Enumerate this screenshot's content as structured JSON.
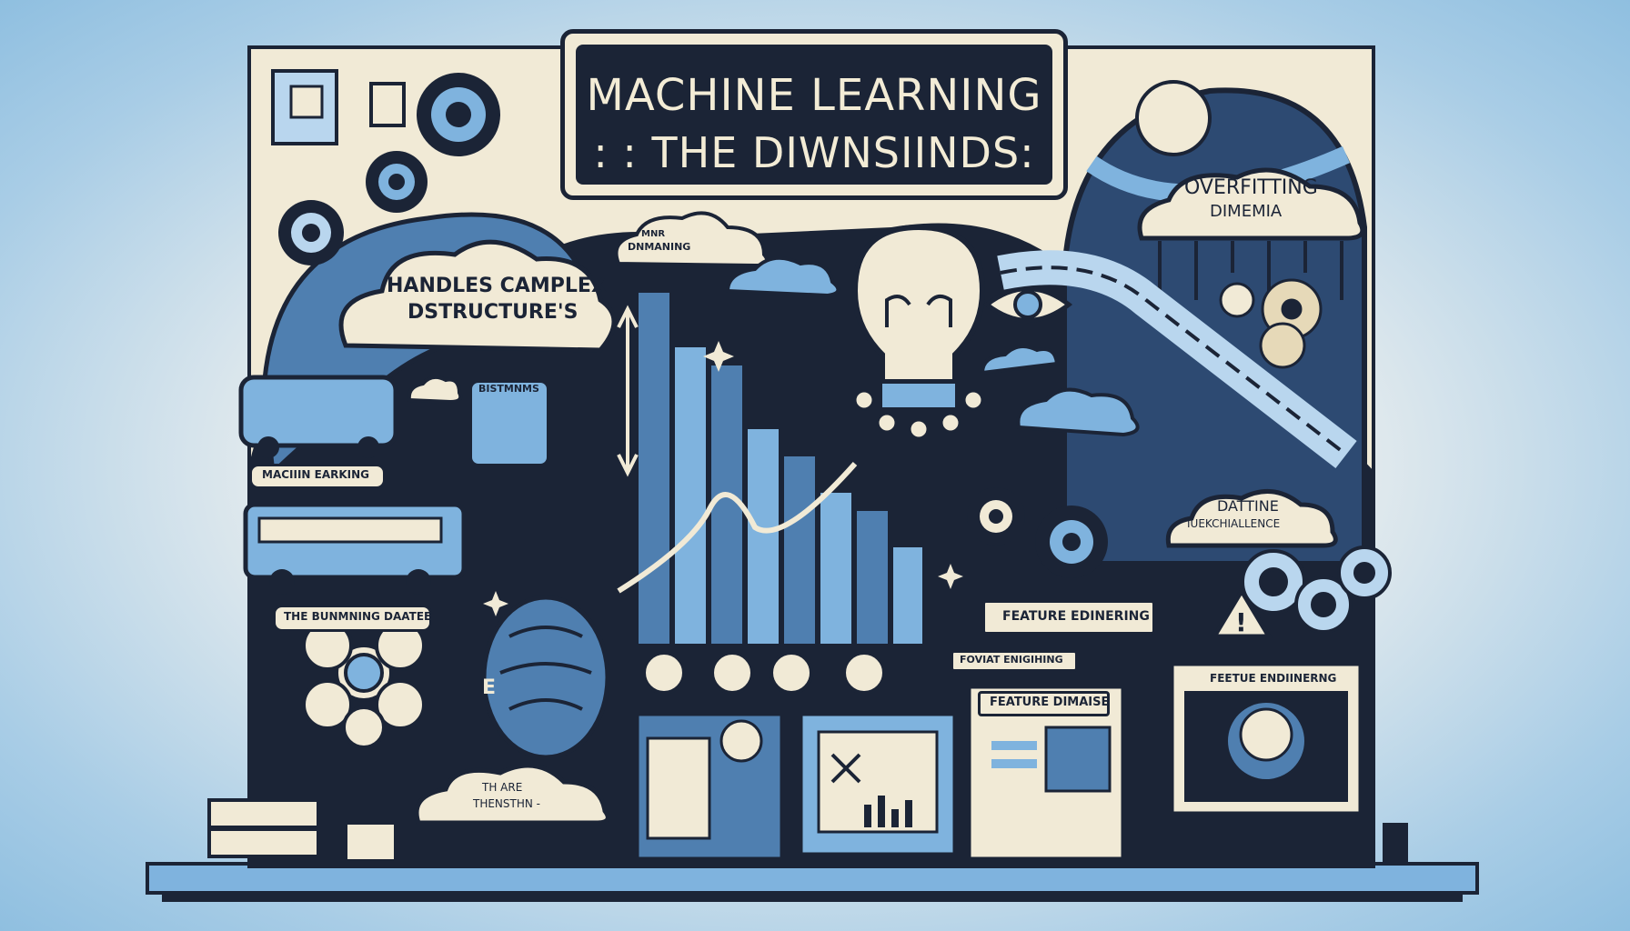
{
  "title": {
    "line1": "MACHINE LEARNING",
    "line2": ": : THE DIWNSIINDS:"
  },
  "labels": {
    "handles": {
      "line1": "HANDLES CAMPLEX",
      "line2": "DSTRUCTURE'S"
    },
    "mnr": {
      "line1": "MNR",
      "line2": "DNMANING"
    },
    "overfitting": {
      "line1": "OVERFITTING",
      "line2": "DIMEMIA"
    },
    "bistmnms": "BISTMNMS",
    "machin_earning": "MACIIIN EARKING",
    "bunmning": "THE BUNMNING DAATEE",
    "datine": {
      "line1": "DATTINE",
      "line2": "IUEKCHIALLENCE"
    },
    "feature_ed": "FEATURE EDINERING",
    "fovat": "FOVIAT ENIGIHING",
    "feature_dim": "FEATURE DIMAISE",
    "featue_end": "FEETUE ENDIINERNG",
    "th_are": {
      "line1": "TH ARE",
      "line2": "THENSTHN -"
    },
    "e_letter": "E"
  },
  "colors": {
    "navy": "#1b2436",
    "blue": "#7fb3de",
    "cream": "#f1ead6",
    "mid": "#4f7fb0",
    "light": "#b9d6ee"
  }
}
